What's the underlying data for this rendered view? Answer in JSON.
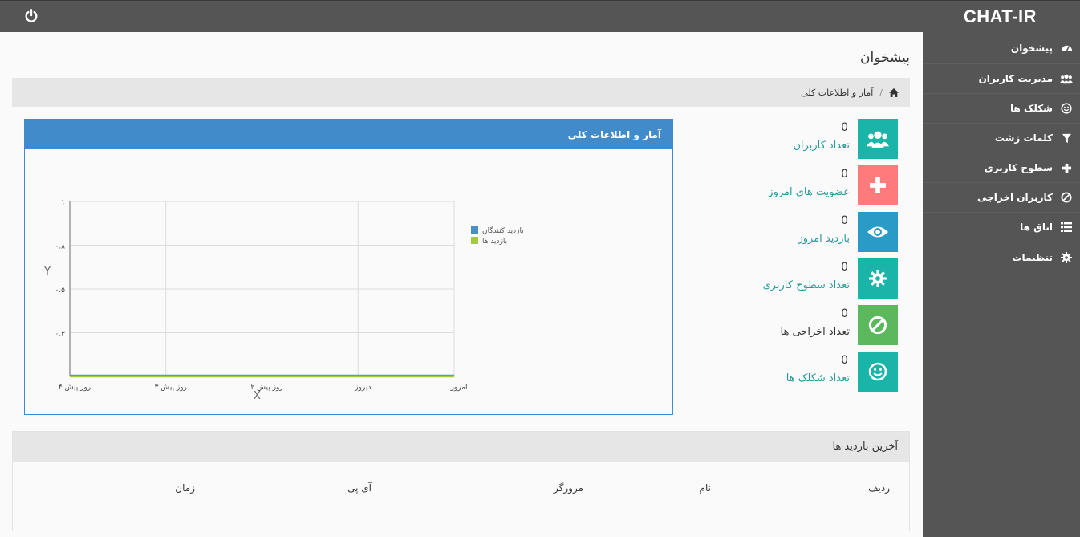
{
  "header": {
    "brand": "CHAT-IR",
    "power_icon": "power-icon"
  },
  "sidebar": {
    "items": [
      {
        "label": "پیشخوان",
        "icon": "dashboard-icon"
      },
      {
        "label": "مدیریت کاربران",
        "icon": "users-icon"
      },
      {
        "label": "شکلک ها",
        "icon": "smile-icon"
      },
      {
        "label": "کلمات زشت",
        "icon": "filter-icon"
      },
      {
        "label": "سطوح کاربری",
        "icon": "plus-icon"
      },
      {
        "label": "کاربران اخراجی",
        "icon": "ban-icon"
      },
      {
        "label": "اتاق ها",
        "icon": "list-icon"
      },
      {
        "label": "تنظیمات",
        "icon": "gear-icon"
      }
    ]
  },
  "page": {
    "title": "پیشخوان",
    "breadcrumb": "آمار و اطلاعات کلی"
  },
  "stats": [
    {
      "value": "0",
      "label": "تعداد کاربران",
      "color": "#1ab5a8",
      "icon": "users-icon"
    },
    {
      "value": "0",
      "label": "عضویت های امروز",
      "color": "#ff7b7b",
      "icon": "plus-icon"
    },
    {
      "value": "0",
      "label": "بازدید امروز",
      "color": "#2a9bc6",
      "icon": "eye-icon"
    },
    {
      "value": "0",
      "label": "تعداد سطوح کاربری",
      "color": "#1ab5a8",
      "icon": "gear-icon"
    },
    {
      "value": "0",
      "label": "تعداد اخراجی ها",
      "color": "#5cb85c",
      "icon": "ban-icon"
    },
    {
      "value": "0",
      "label": "تعداد شکلک ها",
      "color": "#1ab5a8",
      "icon": "smile-icon"
    }
  ],
  "chart_panel": {
    "title": "آمار و اطلاعات کلی"
  },
  "chart_data": {
    "type": "line",
    "x": [
      "روز پیش ۴",
      "روز پیش ۳",
      "روز پیش ۲",
      "دیروز",
      "امروز"
    ],
    "series": [
      {
        "name": "بازدید کنندگان",
        "values": [
          0,
          0,
          0,
          0,
          0
        ],
        "color": "#4a90c8"
      },
      {
        "name": "بازدید ها",
        "values": [
          0,
          0,
          0,
          0,
          0
        ],
        "color": "#a0cc3a"
      }
    ],
    "yticks": [
      "۰",
      "۰.۳",
      "۰.۵",
      "۰.۸",
      "۱"
    ],
    "ylim": [
      0,
      1
    ],
    "xlabel": "X",
    "ylabel": "Y",
    "grid": true,
    "legend": "top-right"
  },
  "visits": {
    "title": "آخرین بازدید ها",
    "columns": [
      "ردیف",
      "نام",
      "مرورگر",
      "آی پی",
      "زمان"
    ]
  }
}
